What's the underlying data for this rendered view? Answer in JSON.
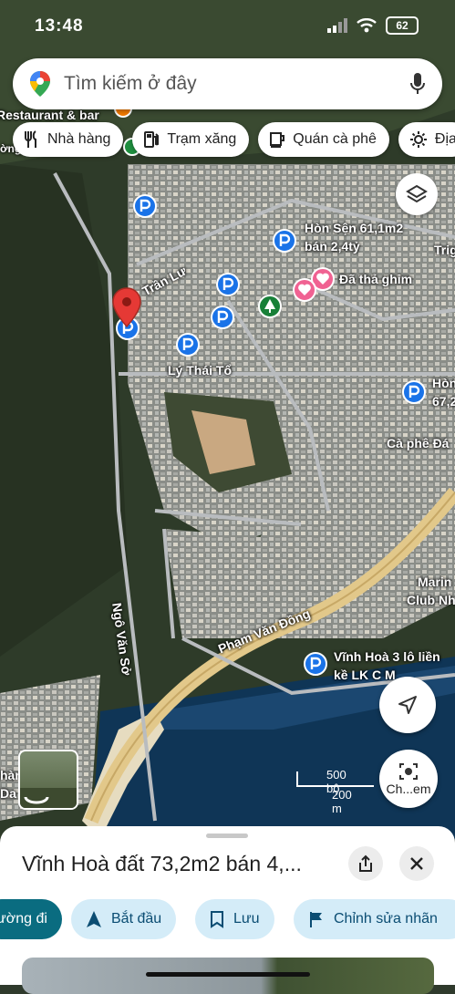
{
  "status_bar": {
    "time": "13:48",
    "battery": "62"
  },
  "search": {
    "placeholder": "Tìm kiếm ở đây"
  },
  "chips": [
    {
      "icon": "fork-knife-icon",
      "label": "Nhà hàng"
    },
    {
      "icon": "gas-pump-icon",
      "label": "Trạm xăng"
    },
    {
      "icon": "coffee-cup-icon",
      "label": "Quán cà phê"
    },
    {
      "icon": "gear-icon",
      "label": "Địa"
    }
  ],
  "map_labels": {
    "restaurant": "Restaurant & bar",
    "partial_top": "ờng",
    "hon_sen_1": "Hòn Sện 61,1m2",
    "hon_sen_2": "bán 2,4tỷ",
    "saved": "Đã thả ghim",
    "trig": "Trig",
    "tran_lu": "Trần Lư",
    "ly_thai_to": "Lý Thái Tổ",
    "hon_right_1": "Hòn",
    "hon_right_2": "67,2",
    "cafe": "Cà phê Đá",
    "ngo_van_so": "Ngô Văn Sở",
    "pham_van_dong": "Phạm Văn Đồng",
    "marina_1": "Marin",
    "marina_2": "Club Nh",
    "vinh_hoa_1": "Vĩnh Hoà 3 lô liền",
    "vinh_hoa_2": "kề LK C M",
    "left_partial_1": "hàn",
    "left_partial_2": "Da"
  },
  "scale": {
    "imperial": "500 bộ",
    "metric": "200 m"
  },
  "camera_button": {
    "label": "Ch...em"
  },
  "place_sheet": {
    "title": "Vĩnh Hoà đất 73,2m2 bán 4,...",
    "actions": {
      "directions": "ường đi",
      "start": "Bắt đầu",
      "save": "Lưu",
      "edit": "Chỉnh sửa nhãn"
    }
  },
  "colors": {
    "accent": "#0a6c80",
    "pin_red": "#e53935",
    "marker_blue": "#1a73e8",
    "saved_pink": "#f06292"
  }
}
